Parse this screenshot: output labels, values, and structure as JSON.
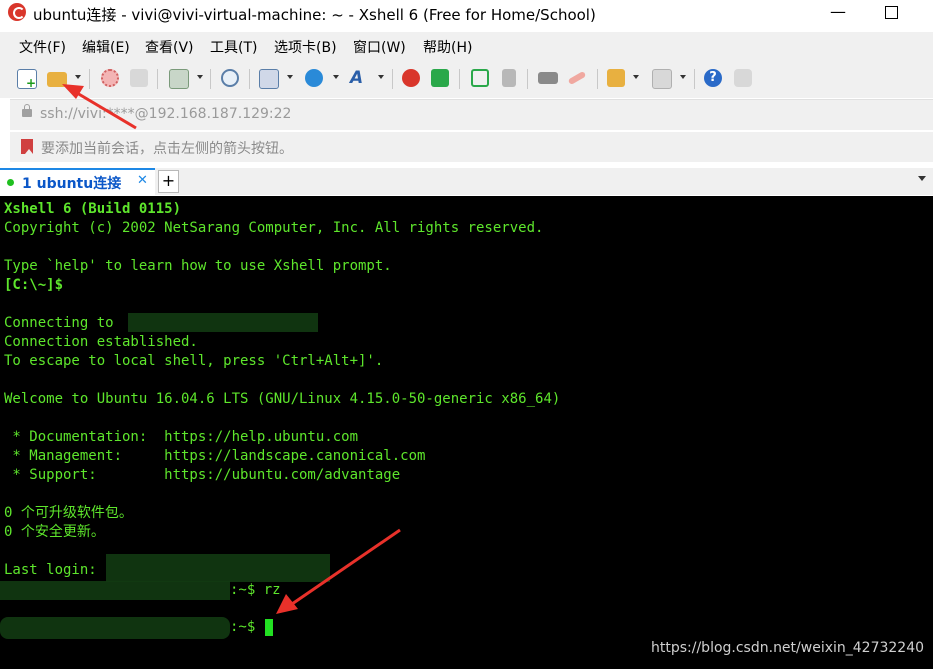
{
  "window": {
    "title": "ubuntu连接 - vivi@vivi-virtual-machine: ~ - Xshell 6 (Free for Home/School)",
    "minimize_glyph": "—",
    "maximize_glyph": ""
  },
  "menu": [
    "文件(F)",
    "编辑(E)",
    "查看(V)",
    "工具(T)",
    "选项卡(B)",
    "窗口(W)",
    "帮助(H)"
  ],
  "toolbar": {
    "icons": [
      "new-session-icon",
      "open-folder-icon",
      "reconnect-icon",
      "disconnect-icon",
      "properties-icon",
      "find-icon",
      "transfer-icon",
      "globe-icon",
      "font-icon",
      "xftp-icon",
      "xmanager-icon",
      "fullscreen-icon",
      "lock-icon",
      "keyboard-icon",
      "highlight-icon",
      "compose-icon",
      "layout-icon",
      "help-icon",
      "chat-icon"
    ]
  },
  "address_bar": {
    "text": "ssh://vivi:****@192.168.187.129:22"
  },
  "hint_bar": {
    "text": "要添加当前会话，点击左侧的箭头按钮。"
  },
  "tabs": [
    {
      "label": "1 ubuntu连接",
      "close": "✕",
      "status_color": "#1fbf1f"
    }
  ],
  "tab_add_label": "+",
  "terminal": {
    "lines": [
      "Xshell 6 (Build 0115)",
      "Copyright (c) 2002 NetSarang Computer, Inc. All rights reserved.",
      "",
      "Type `help' to learn how to use Xshell prompt.",
      "[C:\\~]$",
      "",
      "Connecting to",
      "Connection established.",
      "To escape to local shell, press 'Ctrl+Alt+]'.",
      "",
      "Welcome to Ubuntu 16.04.6 LTS (GNU/Linux 4.15.0-50-generic x86_64)",
      "",
      " * Documentation:  https://help.ubuntu.com",
      " * Management:     https://landscape.canonical.com",
      " * Support:        https://ubuntu.com/advantage",
      "",
      "0 个可升级软件包。",
      "0 个安全更新。",
      "",
      "Last login:",
      ":~$ rz",
      "",
      ":~$ "
    ],
    "text_color": "#5ee62c"
  },
  "watermark": "https://blog.csdn.net/weixin_42732240",
  "colors": {
    "terminal_bg": "#000000",
    "terminal_fg": "#5ee62c",
    "annotation_red": "#e8312a",
    "tab_accent": "#1e88e5"
  }
}
